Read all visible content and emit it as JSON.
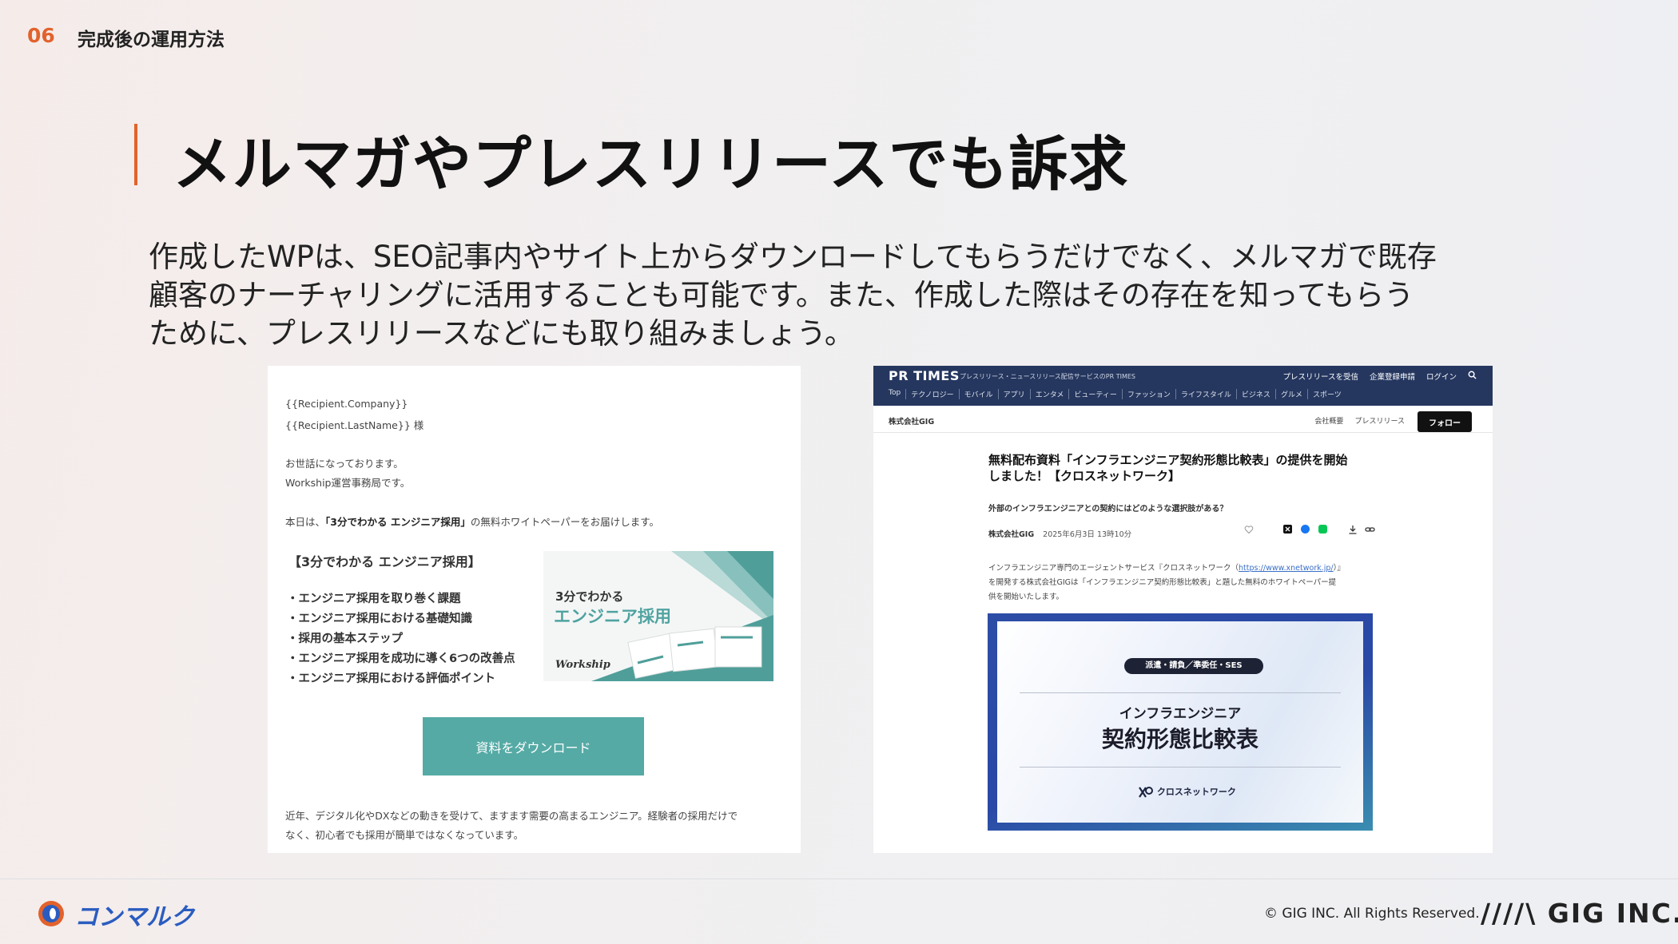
{
  "header": {
    "section_number": "06",
    "section_title": "完成後の運用方法"
  },
  "slide": {
    "title": "メルマガやプレスリリースでも訴求",
    "body_lines": [
      "作成したWPは、SEO記事内やサイト上からダウンロードしてもらうだけでなく、メルマガで既存",
      "顧客のナーチャリングに活用することも可能です。また、作成した際はその存在を知ってもらう",
      "ために、プレスリリースなどにも取り組みましょう。"
    ]
  },
  "email": {
    "recipient_company": "{{Recipient.Company}}",
    "recipient_name": "{{Recipient.LastName}} 様",
    "greeting": "お世話になっております。",
    "sender": "Workship運営事務局です。",
    "intro_before": "本日は、",
    "intro_bold": "「3分でわかる エンジニア採用」",
    "intro_after": "の無料ホワイトペーパーをお届けします。",
    "wp_heading": "【3分でわかる エンジニア採用】",
    "wp_items": [
      "・エンジニア採用を取り巻く課題",
      "・エンジニア採用における基礎知識",
      "・採用の基本ステップ",
      "・エンジニア採用を成功に導く6つの改善点",
      "・エンジニア採用における評価ポイント"
    ],
    "thumb_line1": "3分でわかる",
    "thumb_line2": "エンジニア採用",
    "thumb_brand": "Workship",
    "download_label": "資料をダウンロード",
    "footer_line1": "近年、デジタル化やDXなどの動きを受けて、ますます需要の高まるエンジニア。経験者の採用だけで",
    "footer_line2": "なく、初心者でも採用が簡単ではなくなっています。"
  },
  "press": {
    "logo": "PR TIMES",
    "tagline": "プレスリリース・ニュースリリース配信サービスのPR TIMES",
    "nav_right": [
      "プレスリリースを受信",
      "企業登録申請",
      "ログイン"
    ],
    "categories": [
      "Top",
      "テクノロジー",
      "モバイル",
      "アプリ",
      "エンタメ",
      "ビューティー",
      "ファッション",
      "ライフスタイル",
      "ビジネス",
      "グルメ",
      "スポーツ"
    ],
    "company": "株式会社GIG",
    "company_links": [
      "会社概要",
      "プレスリリース"
    ],
    "follow_label": "フォロー",
    "headline_line1": "無料配布資料「インフラエンジニア契約形態比較表」の提供を開始",
    "headline_line2": "しました！【クロスネットワーク】",
    "subheadline": "外部のインフラエンジニアとの契約にはどのような選択肢がある？",
    "meta_company": "株式会社GIG",
    "meta_date": "2025年6月3日 13時10分",
    "body_line1_before": "インフラエンジニア専門のエージェントサービス『クロスネットワーク（",
    "body_link": "https://www.xnetwork.jp/",
    "body_line1_after": "）』",
    "body_line2": "を開発する株式会社GIGは「インフラエンジニア契約形態比較表」と題した無料のホワイトペーパー提",
    "body_line3": "供を開始いたします。",
    "image_pill": "派遣・請負／準委任・SES",
    "image_title1": "インフラエンジニア",
    "image_title2": "契約形態比較表",
    "image_logo": "クロスネットワーク"
  },
  "footer": {
    "brand_name": "コンマルク",
    "copyright": "© GIG INC. All Rights Reserved.",
    "company_logo": "////\\ GIG INC."
  },
  "colors": {
    "accent": "#e2622c",
    "teal_button": "#55aaa5",
    "prtimes_nav": "#25375f",
    "brand_blue": "#2a5cc0"
  }
}
